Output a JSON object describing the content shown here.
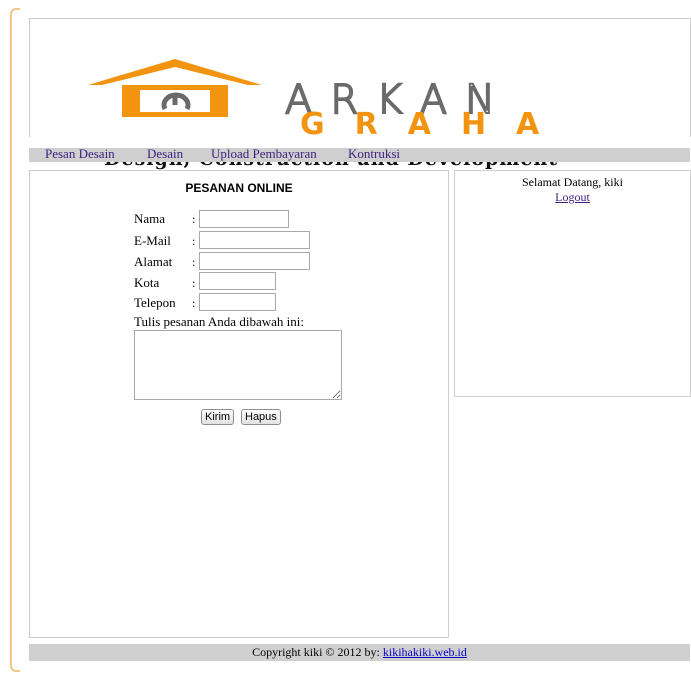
{
  "brand": {
    "name_top": "ARKAN",
    "name_bottom": "GRAHA",
    "tagline": "Design, Construction and Development",
    "accent_color": "#f29410"
  },
  "nav": {
    "items": [
      {
        "label": "Pesan Desain"
      },
      {
        "label": "Desain"
      },
      {
        "label": "Upload Pembayaran"
      },
      {
        "label": "Kontruksi"
      }
    ]
  },
  "form": {
    "title": "PESANAN ONLINE",
    "fields": [
      {
        "label": "Nama",
        "value": ""
      },
      {
        "label": "E-Mail",
        "value": ""
      },
      {
        "label": "Alamat",
        "value": ""
      },
      {
        "label": "Kota",
        "value": ""
      },
      {
        "label": "Telepon",
        "value": ""
      }
    ],
    "colon": ":",
    "message_label": "Tulis pesanan Anda dibawah ini:",
    "message_value": "",
    "submit_label": "Kirim",
    "reset_label": "Hapus"
  },
  "sidebar": {
    "welcome": "Selamat Datang, kiki",
    "logout": "Logout"
  },
  "footer": {
    "text": "Copyright kiki © 2012 by: ",
    "link": "kikihakiki.web.id"
  }
}
